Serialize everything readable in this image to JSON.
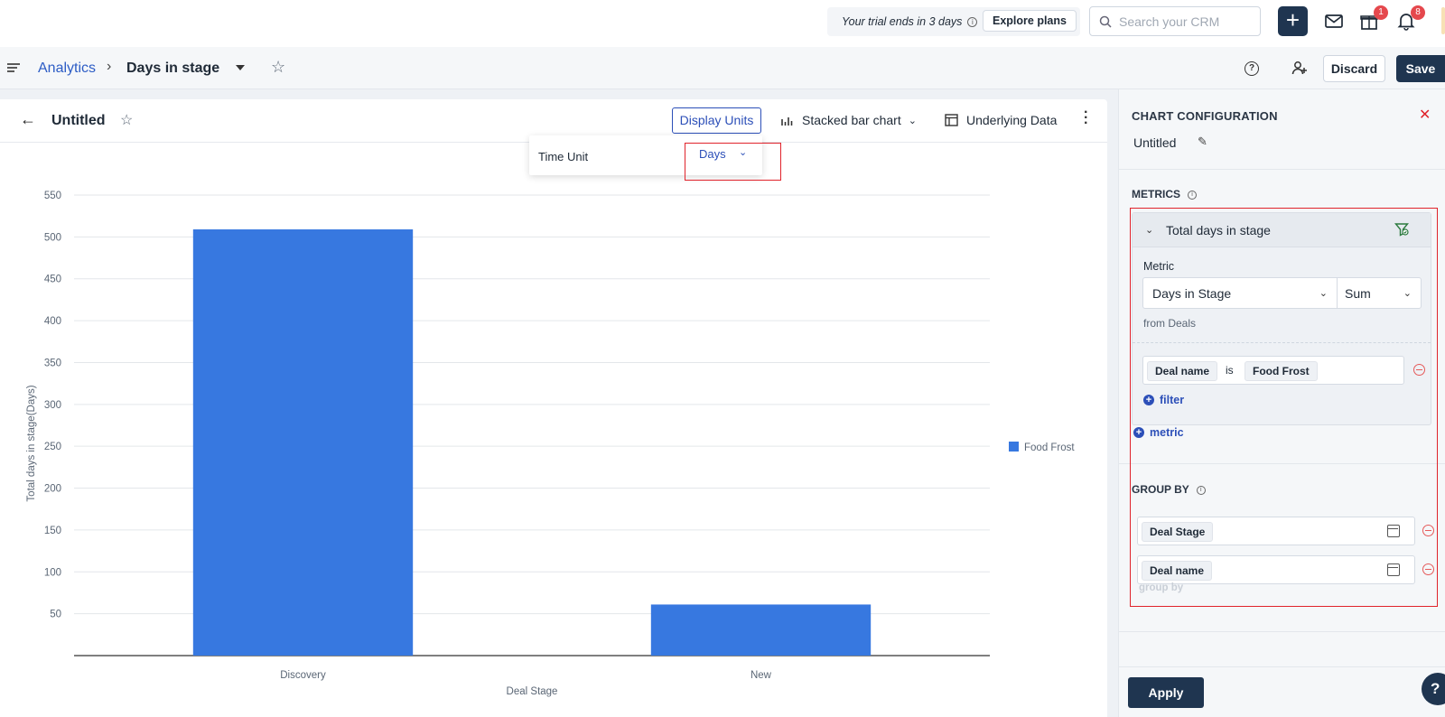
{
  "topbar": {
    "trial_text": "Your trial ends in 3 days",
    "explore_label": "Explore plans",
    "search_placeholder": "Search your CRM",
    "gift_badge": "1",
    "bell_badge": "8"
  },
  "breadcrumb": {
    "root": "Analytics",
    "current": "Days in stage"
  },
  "header_actions": {
    "discard_label": "Discard",
    "save_label": "Save"
  },
  "card": {
    "title": "Untitled",
    "display_units_label": "Display Units",
    "chart_type_label": "Stacked bar chart",
    "underlying_label": "Underlying Data"
  },
  "popover": {
    "time_unit_label": "Time Unit",
    "time_unit_value": "Days"
  },
  "chart_data": {
    "type": "bar",
    "categories": [
      "Discovery",
      "New"
    ],
    "series": [
      {
        "name": "Food Frost",
        "values": [
          509,
          61
        ],
        "color": "#3778e0"
      }
    ],
    "xlabel": "Deal Stage",
    "ylabel": "Total days in stage(Days)",
    "yticks": [
      50,
      100,
      150,
      200,
      250,
      300,
      350,
      400,
      450,
      500,
      550
    ],
    "ylim": [
      0,
      550
    ],
    "grid": true,
    "legend_position": "right"
  },
  "config": {
    "title": "CHART CONFIGURATION",
    "chart_name": "Untitled",
    "metrics_heading": "METRICS",
    "metric_name": "Total days in stage",
    "metric_label": "Metric",
    "metric_field": "Days in Stage",
    "metric_agg": "Sum",
    "from_text": "from Deals",
    "filter_field": "Deal name",
    "filter_op": "is",
    "filter_value": "Food Frost",
    "add_filter_label": "filter",
    "add_metric_label": "metric",
    "groupby_heading": "GROUP BY",
    "group_fields": [
      "Deal Stage",
      "Deal name"
    ],
    "add_group_label": "group by",
    "apply_label": "Apply"
  },
  "colors": {
    "accent": "#2c4fb8",
    "primary_dark": "#1f3550",
    "bar": "#3778e0",
    "highlight": "#e0232b"
  }
}
